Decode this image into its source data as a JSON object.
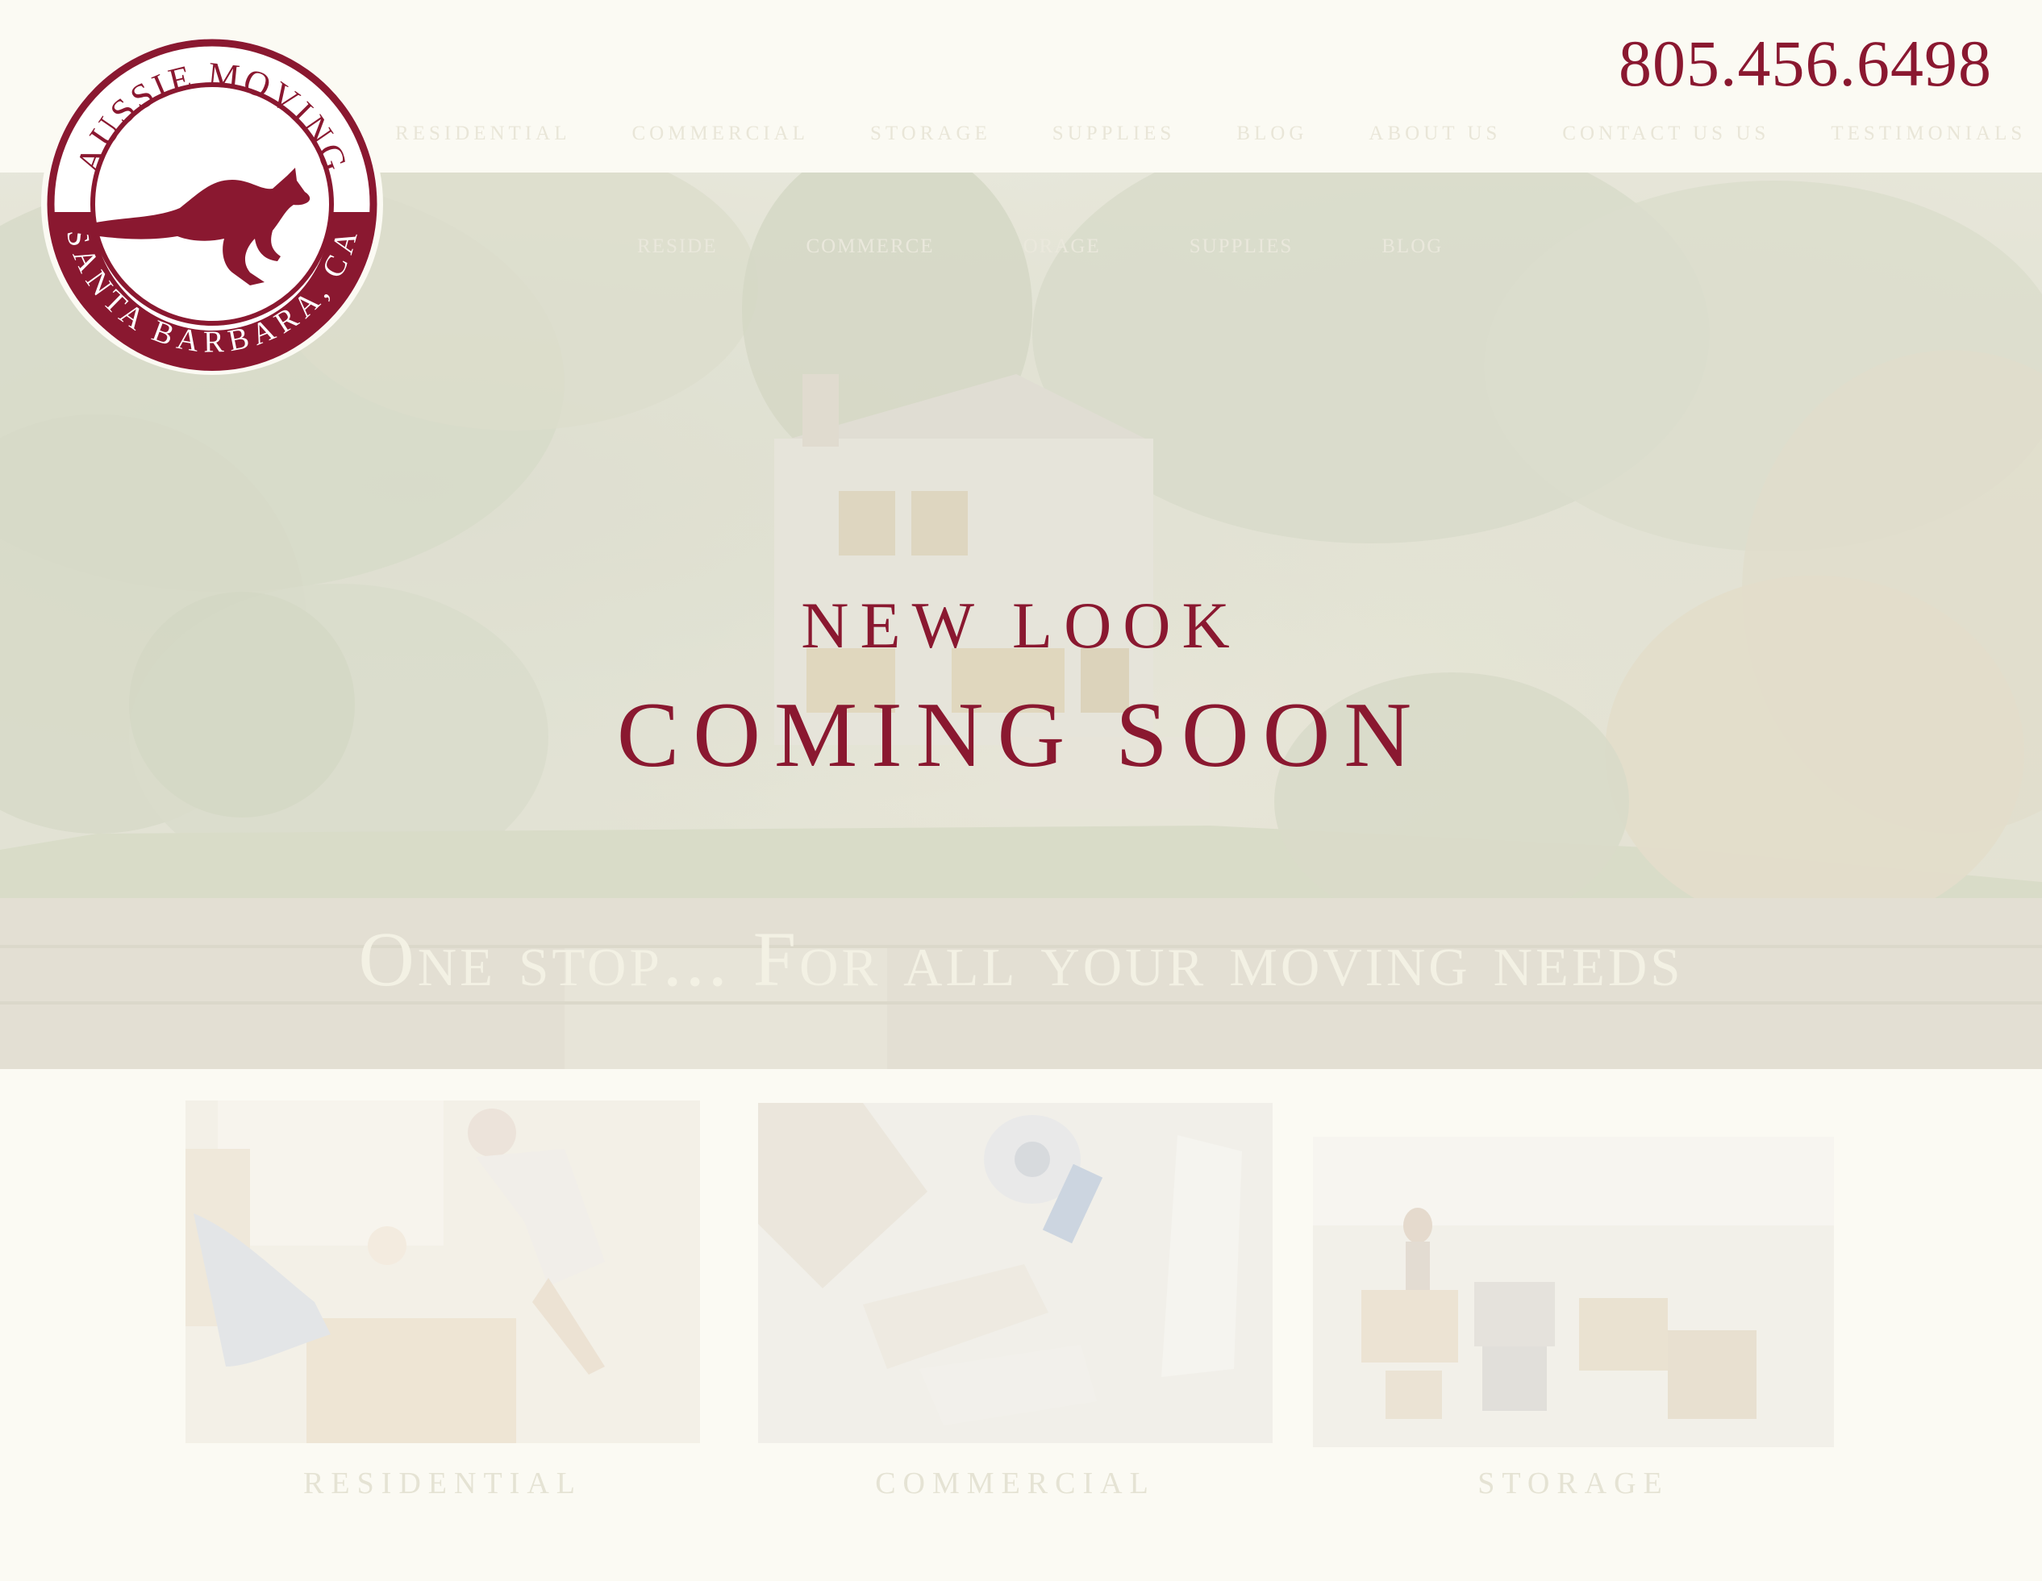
{
  "header": {
    "phone": "805.456.6498",
    "nav": [
      "RESIDENTIAL",
      "COMMERCIAL",
      "STORAGE",
      "SUPPLIES",
      "BLOG",
      "ABOUT US",
      "CONTACT US US",
      "TESTIMONIALS"
    ]
  },
  "logo": {
    "top_text": "AUSSIE MOVING",
    "bottom_text": "SANTA BARBARA, CA",
    "icon": "kangaroo-icon"
  },
  "hero": {
    "sub_nav": [
      "RESIDE",
      "COMMERCE",
      "ORAGE",
      "SUPPLIES",
      "BLOG"
    ],
    "headline_small": "NEW LOOK",
    "headline_big": "COMING SOON",
    "tagline": "One stop... For all your moving needs"
  },
  "services": [
    {
      "label": "RESIDENTIAL"
    },
    {
      "label": "COMMERCIAL"
    },
    {
      "label": "STORAGE"
    }
  ],
  "colors": {
    "brand": "#8a1830",
    "background": "#fbfaf3"
  }
}
